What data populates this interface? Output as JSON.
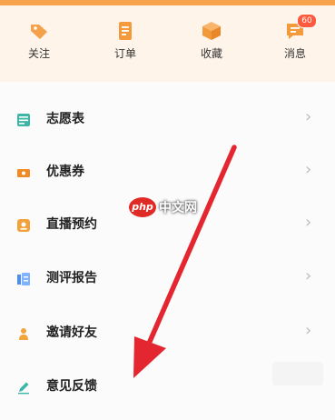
{
  "quick_actions": [
    {
      "label": "关注",
      "icon": "tag-icon"
    },
    {
      "label": "订单",
      "icon": "order-icon"
    },
    {
      "label": "收藏",
      "icon": "box-icon"
    },
    {
      "label": "消息",
      "icon": "message-icon",
      "badge": "60"
    }
  ],
  "menu": [
    {
      "label": "志愿表",
      "icon": "table-icon"
    },
    {
      "label": "优惠券",
      "icon": "coupon-icon"
    },
    {
      "label": "直播预约",
      "icon": "live-icon"
    },
    {
      "label": "测评报告",
      "icon": "report-icon"
    },
    {
      "label": "邀请好友",
      "icon": "person-icon"
    },
    {
      "label": "意见反馈",
      "icon": "pencil-icon"
    }
  ],
  "chevron": "›",
  "watermark": {
    "logo": "php",
    "text": "中文网"
  },
  "colors": {
    "accent": "#f6a24a",
    "arrow": "#e3262f",
    "badge": "#ff5a3d"
  }
}
